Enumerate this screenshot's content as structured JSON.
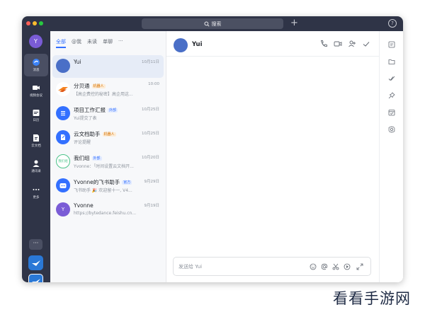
{
  "search": {
    "label": "搜索"
  },
  "rail": {
    "avatar_letter": "Y",
    "items": [
      {
        "label": "消息"
      },
      {
        "label": "视频会议"
      },
      {
        "label": "日历"
      },
      {
        "label": "云文档"
      },
      {
        "label": "通讯录"
      },
      {
        "label": "更多"
      }
    ]
  },
  "tabs": [
    "全部",
    "@我",
    "未读",
    "单聊",
    "···"
  ],
  "chats": [
    {
      "name": "Yui",
      "badge": "",
      "preview": "",
      "time": "10月11日",
      "avatar_color": "#4a6fc7",
      "avatar_text": ""
    },
    {
      "name": "分贝通",
      "badge": "机器人",
      "badge_type": "orange",
      "preview": "【高企费控的秘密】高企用这...",
      "time": "10:00",
      "avatar_color": "#ffffff",
      "avatar_text": ""
    },
    {
      "name": "项目工作汇报",
      "badge": "外部",
      "badge_type": "blue",
      "preview": "Yui提交了表",
      "time": "10月25日",
      "avatar_color": "#3370ff",
      "avatar_text": "≡"
    },
    {
      "name": "云文档助手",
      "badge": "机器人",
      "badge_type": "orange",
      "preview": "评论提醒",
      "time": "10月25日",
      "avatar_color": "#3370ff",
      "avatar_text": ""
    },
    {
      "name": "我们组",
      "badge": "外部",
      "badge_type": "blue",
      "preview": "Yvonne：「时间设置云文档开...",
      "time": "10月20日",
      "avatar_color": "#ffffff",
      "avatar_text": "我们组"
    },
    {
      "name": "Yvonne的飞书助手",
      "badge": "官方",
      "badge_type": "blue",
      "preview": "飞书助手 🎉 欢迎留十一, V4...",
      "time": "9月29日",
      "avatar_color": "#3370ff",
      "avatar_text": ""
    },
    {
      "name": "Yvonne",
      "badge": "",
      "preview": "https://bytedance.feishu.cn...",
      "time": "9月19日",
      "avatar_color": "#7a5cd6",
      "avatar_text": "Y"
    }
  ],
  "main": {
    "title": "Yui",
    "input_placeholder": "发送给 Yui"
  },
  "watermark": "看看手游网",
  "colors": {
    "accent": "#3370ff",
    "rail": "#2f3447"
  }
}
